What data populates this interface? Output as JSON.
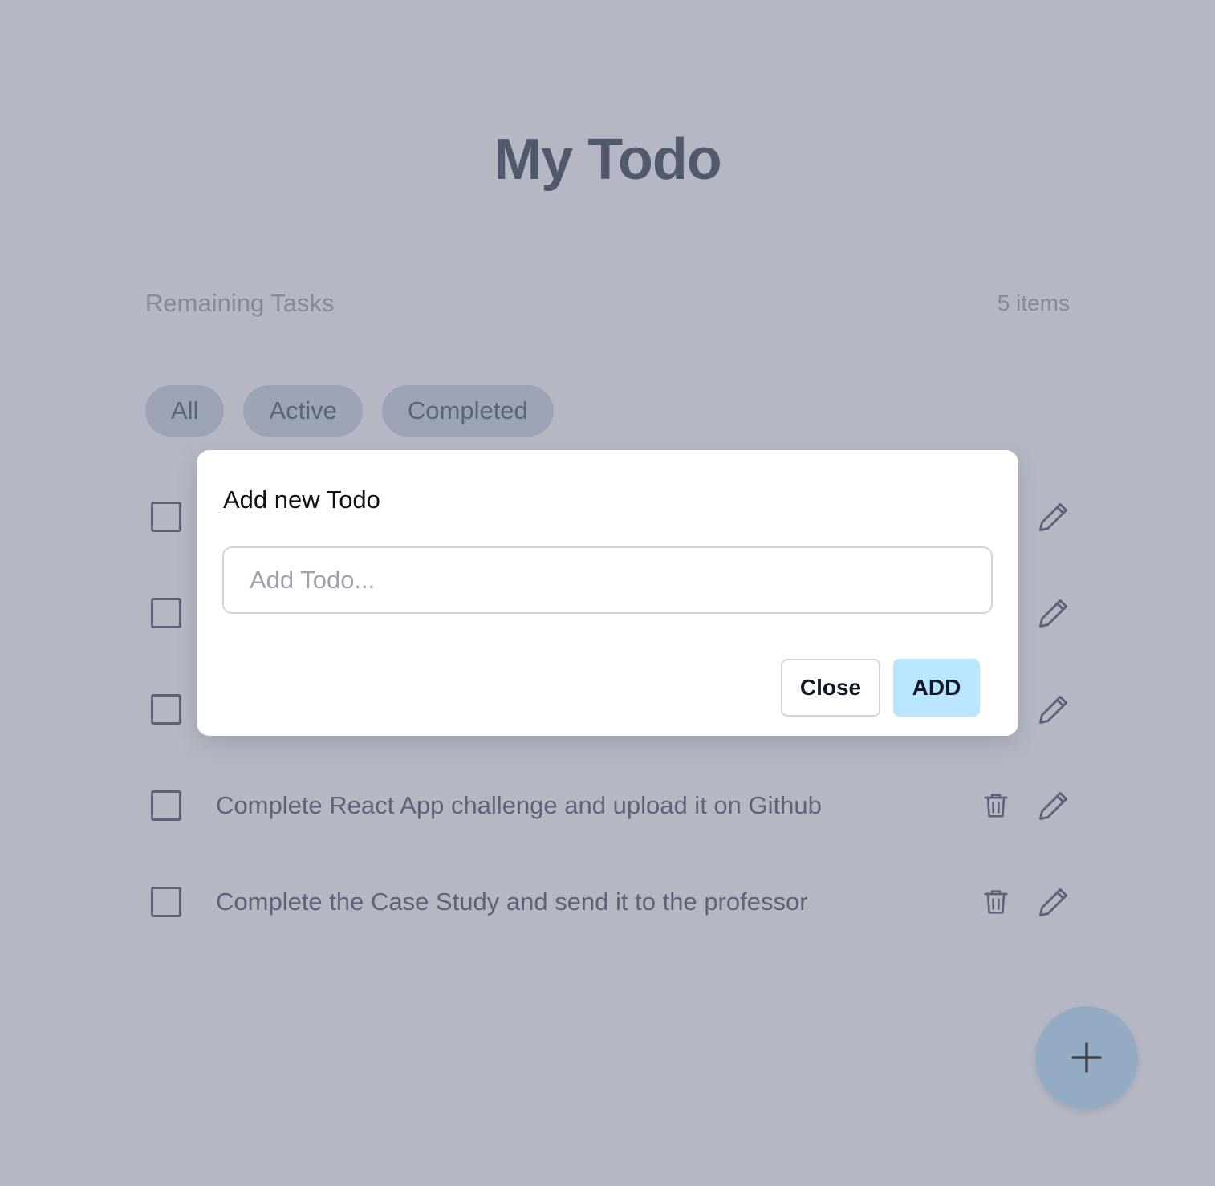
{
  "app": {
    "title": "My Todo"
  },
  "summary": {
    "remaining_label": "Remaining Tasks",
    "item_count": "5 items"
  },
  "filters": [
    {
      "label": "All"
    },
    {
      "label": "Active"
    },
    {
      "label": "Completed"
    }
  ],
  "todos": [
    {
      "text": "",
      "completed": false
    },
    {
      "text": "",
      "completed": false
    },
    {
      "text": "",
      "completed": false
    },
    {
      "text": "Complete React App challenge and upload it on Github",
      "completed": false
    },
    {
      "text": "Complete the Case Study and send it to the professor",
      "completed": false
    }
  ],
  "modal": {
    "title": "Add new Todo",
    "input_value": "",
    "input_placeholder": "Add Todo...",
    "close_label": "Close",
    "add_label": "ADD"
  },
  "icons": {
    "delete": "trash-icon",
    "edit": "pencil-icon",
    "fab": "plus-icon"
  },
  "colors": {
    "accent": "#bae6fd",
    "overlay": "#6b728a"
  }
}
